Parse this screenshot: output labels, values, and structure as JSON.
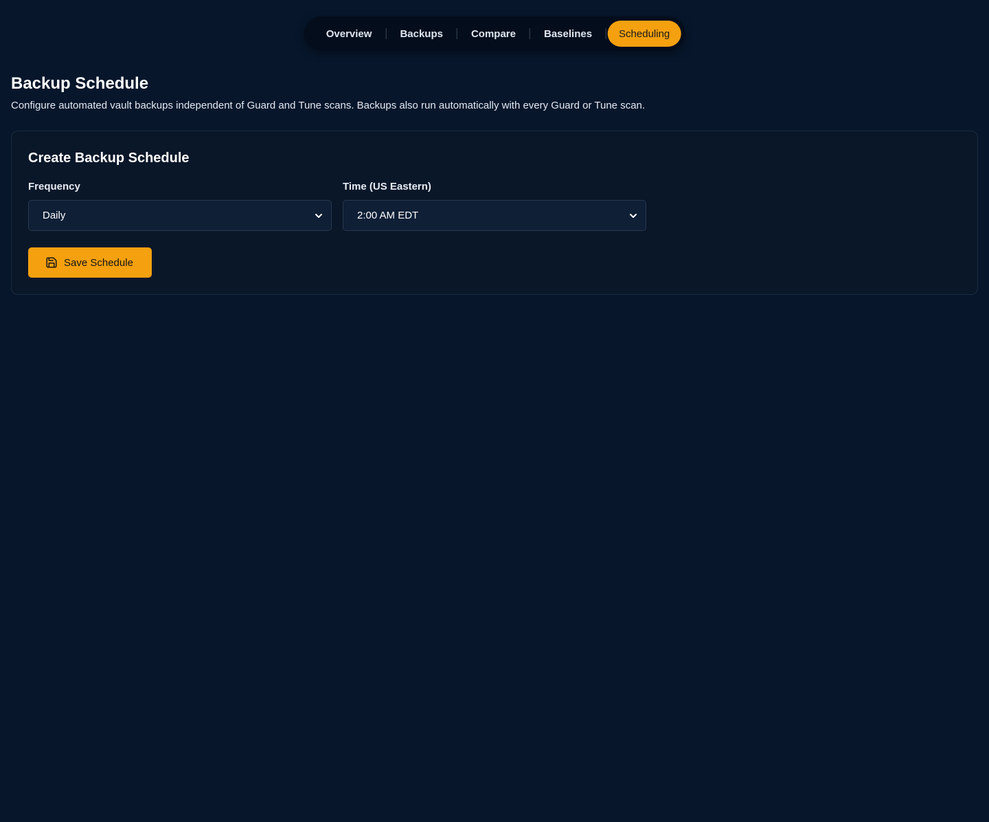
{
  "nav": {
    "tabs": [
      {
        "label": "Overview",
        "active": false
      },
      {
        "label": "Backups",
        "active": false
      },
      {
        "label": "Compare",
        "active": false
      },
      {
        "label": "Baselines",
        "active": false
      },
      {
        "label": "Scheduling",
        "active": true
      }
    ]
  },
  "header": {
    "title": "Backup Schedule",
    "subtitle": "Configure automated vault backups independent of Guard and Tune scans. Backups also run automatically with every Guard or Tune scan."
  },
  "form": {
    "title": "Create Backup Schedule",
    "frequency": {
      "label": "Frequency",
      "value": "Daily"
    },
    "time": {
      "label": "Time (US Eastern)",
      "value": "2:00 AM EDT"
    },
    "save_label": "Save Schedule"
  },
  "colors": {
    "background": "#07162b",
    "accent": "#f5a00f",
    "card": "#0a1729"
  },
  "icons": {
    "save": "save-icon",
    "dropdown": "chevron-down-icon"
  }
}
